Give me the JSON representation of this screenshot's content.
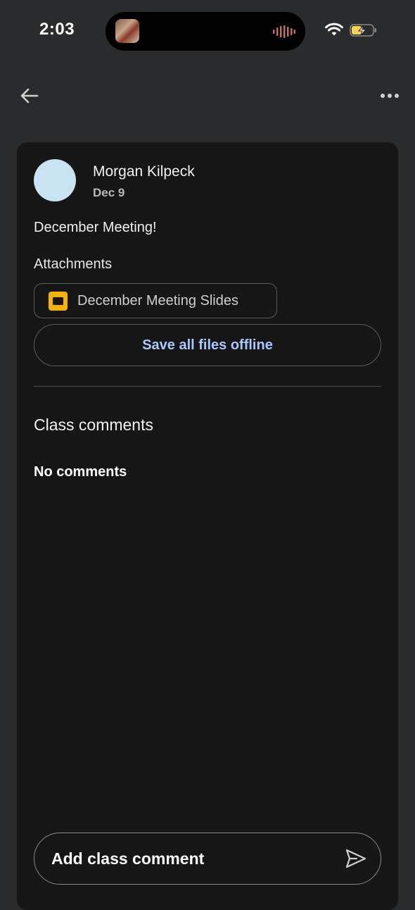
{
  "status_bar": {
    "time": "2:03"
  },
  "top_bar": {
    "back_icon": "arrow-left-icon",
    "more_icon": "more-horizontal-icon"
  },
  "post": {
    "author": "Morgan Kilpeck",
    "date": "Dec 9",
    "text": "December Meeting!",
    "attachments_label": "Attachments",
    "attachments": [
      {
        "name": "December Meeting Slides",
        "icon": "google-slides-icon",
        "color": "#f4b400"
      }
    ],
    "save_offline_label": "Save all files offline"
  },
  "comments": {
    "title": "Class comments",
    "empty_text": "No comments",
    "input_placeholder": "Add class comment",
    "send_icon": "send-icon"
  },
  "colors": {
    "background": "#2a2b2d",
    "card": "#161616",
    "accent": "#a8c7fa",
    "avatar": "#c8e3f2"
  }
}
